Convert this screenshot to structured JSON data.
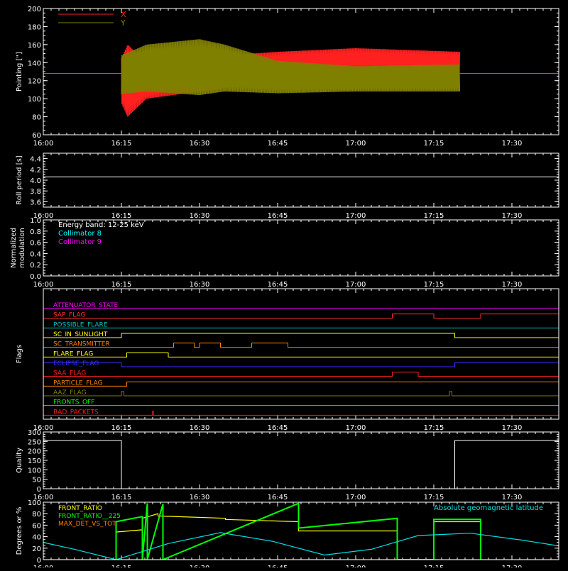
{
  "chart_data": [
    {
      "type": "line",
      "ylabel": "Pointing [\"]",
      "ylim": [
        60,
        200
      ],
      "yticks": [
        60,
        80,
        100,
        120,
        140,
        160,
        180,
        200
      ],
      "xticks": [
        "16:00",
        "16:15",
        "16:30",
        "16:45",
        "17:00",
        "17:15",
        "17:30"
      ],
      "series": [
        {
          "name": "X",
          "color": "#ff2020",
          "baseline": 128,
          "envelope": [
            [
              16.25,
              95,
              145
            ],
            [
              16.27,
              80,
              160
            ],
            [
              16.33,
              100,
              140
            ],
            [
              16.5,
              108,
              148
            ],
            [
              16.58,
              112,
              148
            ],
            [
              16.75,
              120,
              152
            ],
            [
              17.0,
              122,
              156
            ],
            [
              17.333,
              124,
              152
            ]
          ]
        },
        {
          "name": "Y",
          "color": "#808000",
          "baseline": 128,
          "envelope": [
            [
              16.25,
              105,
              148
            ],
            [
              16.33,
              108,
              160
            ],
            [
              16.5,
              104,
              166
            ],
            [
              16.58,
              108,
              160
            ],
            [
              16.75,
              106,
              142
            ],
            [
              17.0,
              108,
              136
            ],
            [
              17.333,
              108,
              138
            ]
          ]
        }
      ]
    },
    {
      "type": "line",
      "ylabel": "Roll period [s]",
      "ylim": [
        3.5,
        4.5
      ],
      "yticks": [
        3.6,
        3.8,
        4.0,
        4.2,
        4.4
      ],
      "xticks": [
        "16:00",
        "16:15",
        "16:30",
        "16:45",
        "17:00",
        "17:15",
        "17:30"
      ],
      "series": [
        {
          "name": "",
          "color": "#ffffff",
          "x": [
            16.0,
            17.65
          ],
          "y": [
            4.06,
            4.06
          ]
        }
      ]
    },
    {
      "type": "line",
      "ylabel": "Normalized modulation",
      "ylim": [
        0.0,
        1.0
      ],
      "yticks": [
        0.0,
        0.2,
        0.4,
        0.6,
        0.8,
        1.0
      ],
      "xticks": [
        "16:00",
        "16:15",
        "16:30",
        "16:45",
        "17:00",
        "17:15",
        "17:30"
      ],
      "annotations": [
        "Energy band: 12-25 keV",
        "Collimator 8",
        "Collimator 9"
      ],
      "annotation_colors": [
        "#ffffff",
        "#00ffff",
        "#ff00ff"
      ],
      "series": [
        {
          "name": "Collimator 9",
          "color": "#ff00ff",
          "x": [
            16.0,
            17.65
          ],
          "y": [
            0.0,
            0.0
          ]
        }
      ]
    },
    {
      "type": "line",
      "ylabel": "Flags",
      "xticks": [
        "16:00",
        "16:15",
        "16:30",
        "16:45",
        "17:00",
        "17:15",
        "17:30"
      ],
      "flags": [
        {
          "name": "ATTENUATOR_STATE",
          "color": "#ff00ff",
          "spans": []
        },
        {
          "name": "SAP_FLAG",
          "color": "#ff3030",
          "spans": [
            [
              17.117,
              17.25
            ],
            [
              17.4,
              17.65
            ]
          ]
        },
        {
          "name": "POSSIBLE_FLARE",
          "color": "#00c0c0",
          "spans": []
        },
        {
          "name": "SC_IN_SUNLIGHT",
          "color": "#ffff00",
          "spans": [
            [
              16.25,
              17.317
            ]
          ]
        },
        {
          "name": "SC_TRANSMITTER",
          "color": "#ff8000",
          "spans": [
            [
              16.417,
              16.483
            ],
            [
              16.5,
              16.567
            ],
            [
              16.667,
              16.783
            ]
          ]
        },
        {
          "name": "FLARE_FLAG",
          "color": "#ffff00",
          "spans": [
            [
              16.267,
              16.4
            ]
          ]
        },
        {
          "name": "ECLIPSE_FLAG",
          "color": "#3030ff",
          "spans": [
            [
              16.0,
              16.25
            ],
            [
              17.317,
              17.65
            ]
          ]
        },
        {
          "name": "SAA_FLAG",
          "color": "#ff2020",
          "spans": [
            [
              17.117,
              17.2
            ]
          ]
        },
        {
          "name": "PARTICLE_FLAG",
          "color": "#ff8000",
          "spans": [
            [
              16.267,
              17.65
            ]
          ]
        },
        {
          "name": "AAZ_FLAG",
          "color": "#808000",
          "spans": [
            [
              16.25,
              16.258
            ],
            [
              17.3,
              17.308
            ]
          ]
        },
        {
          "name": "FRONTS_OFF",
          "color": "#00ff00",
          "spans": []
        },
        {
          "name": "BAD_PACKETS",
          "color": "#ff2020",
          "spans": [
            [
              16.35,
              16.352
            ]
          ]
        }
      ]
    },
    {
      "type": "line",
      "ylabel": "Quality",
      "ylim": [
        0,
        300
      ],
      "yticks": [
        0,
        50,
        100,
        150,
        200,
        250,
        300
      ],
      "xticks": [
        "16:00",
        "16:15",
        "16:30",
        "16:45",
        "17:00",
        "17:15",
        "17:30"
      ],
      "series": [
        {
          "name": "",
          "color": "#ffffff",
          "x": [
            16.0,
            16.25,
            16.25,
            17.317,
            17.317,
            17.65
          ],
          "y": [
            255,
            255,
            0,
            0,
            255,
            255
          ]
        }
      ]
    },
    {
      "type": "line",
      "ylabel": "Degrees or %",
      "ylim": [
        0,
        100
      ],
      "yticks": [
        0,
        20,
        40,
        60,
        80,
        100
      ],
      "xticks": [
        "16:00",
        "16:15",
        "16:30",
        "16:45",
        "17:00",
        "17:15",
        "17:30"
      ],
      "annotations": [
        "Absolute geomagnetic latitude"
      ],
      "annotation_colors": [
        "#00e0e0"
      ],
      "series": [
        {
          "name": "FRONT_RATIO",
          "color": "#ffff00",
          "x": [
            16.233,
            16.233,
            16.317,
            16.317,
            16.367,
            16.367,
            16.583,
            16.583,
            16.817,
            16.817,
            17.133,
            17.133,
            17.25,
            17.25,
            17.4
          ],
          "y": [
            0,
            48,
            52,
            72,
            80,
            76,
            72,
            70,
            66,
            50,
            50,
            0,
            0,
            66,
            66
          ]
        },
        {
          "name": "FRONT_RATIO__225",
          "color": "#00ff00",
          "x": [
            16.233,
            16.233,
            16.317,
            16.317,
            16.333,
            16.333,
            16.383,
            16.383,
            16.817,
            16.817,
            17.133,
            17.133,
            17.25,
            17.25,
            17.4,
            17.4
          ],
          "y": [
            0,
            66,
            75,
            0,
            98,
            0,
            97,
            0,
            98,
            55,
            72,
            0,
            0,
            70,
            70,
            0
          ]
        },
        {
          "name": "MAX_DET_VS_TOT",
          "color": "#ff8000",
          "x": [
            16.0,
            17.65
          ],
          "y": [
            0,
            0
          ]
        },
        {
          "name": "Absolute geomagnetic latitude",
          "color": "#00e0e0",
          "x": [
            16.0,
            16.1,
            16.233,
            16.4,
            16.567,
            16.733,
            16.9,
            17.05,
            17.2,
            17.367,
            17.533,
            17.65
          ],
          "y": [
            30,
            18,
            0,
            28,
            47,
            32,
            8,
            18,
            42,
            46,
            34,
            24
          ]
        }
      ]
    }
  ]
}
